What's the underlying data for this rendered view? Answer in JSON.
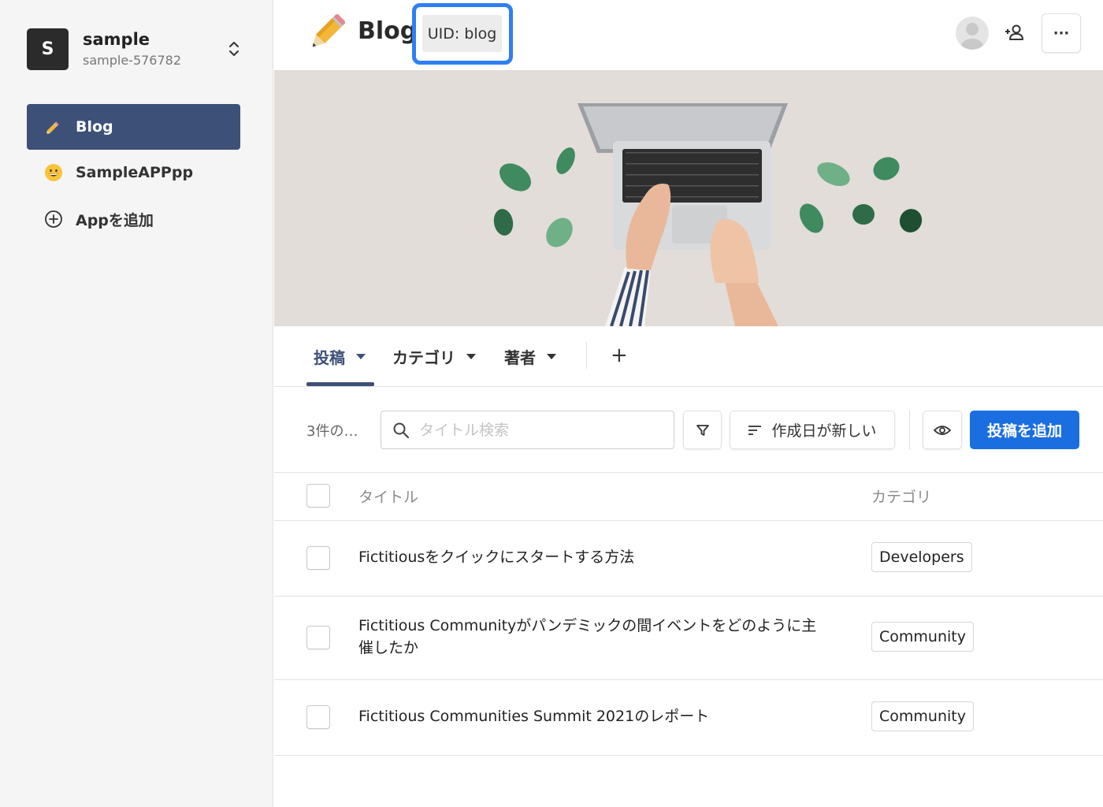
{
  "workspace": {
    "avatar_letter": "S",
    "name": "sample",
    "id": "sample-576782"
  },
  "sidebar": {
    "items": [
      {
        "label": "Blog",
        "icon": "pencil-emoji",
        "active": true
      },
      {
        "label": "SampleAPPpp",
        "icon": "grinning-face-emoji",
        "active": false
      },
      {
        "label": "Appを追加",
        "icon": "plus-circle-icon",
        "active": false
      }
    ]
  },
  "header": {
    "app_title": "Blog",
    "uid_label": "UID: blog",
    "more_label": "···"
  },
  "tabs": {
    "items": [
      {
        "label": "投稿",
        "active": true
      },
      {
        "label": "カテゴリ",
        "active": false
      },
      {
        "label": "著者",
        "active": false
      }
    ],
    "add_label": "+"
  },
  "toolbar": {
    "count_label": "3件の…",
    "search_placeholder": "タイトル検索",
    "sort_label": "作成日が新しい",
    "add_post_label": "投稿を追加"
  },
  "table": {
    "columns": [
      "タイトル",
      "カテゴリ"
    ],
    "rows": [
      {
        "title": "Fictitiousをクイックにスタートする方法",
        "category": "Developers"
      },
      {
        "title": "Fictitious Communityがパンデミックの間イベントをどのように主催したか",
        "category": "Community"
      },
      {
        "title": "Fictitious Communities Summit 2021のレポート",
        "category": "Community"
      }
    ]
  },
  "colors": {
    "accent": "#3d5078",
    "primary_button": "#1b6ee0",
    "highlight_outline": "#2f7ff2"
  }
}
